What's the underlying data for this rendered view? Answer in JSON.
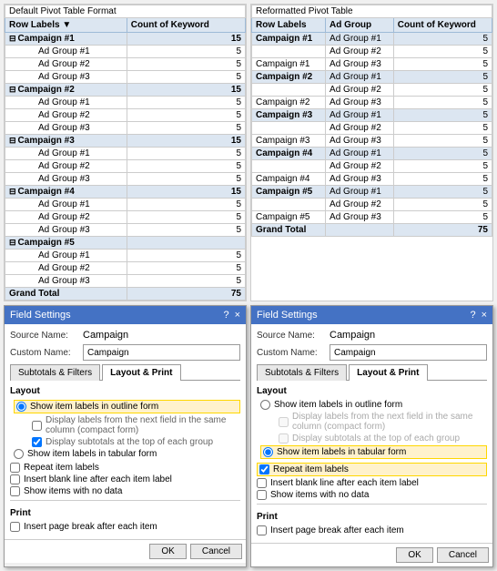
{
  "left_pivot": {
    "title": "Default Pivot Table Format",
    "col1": "Row Labels",
    "col2": "Count of Keyword",
    "rows": [
      {
        "type": "campaign",
        "label": "Campaign #1",
        "value": "15",
        "expanded": true
      },
      {
        "type": "adgroup",
        "label": "Ad Group #1",
        "value": "5"
      },
      {
        "type": "adgroup",
        "label": "Ad Group #2",
        "value": "5"
      },
      {
        "type": "adgroup",
        "label": "Ad Group #3",
        "value": "5"
      },
      {
        "type": "campaign",
        "label": "Campaign #2",
        "value": "15",
        "expanded": true
      },
      {
        "type": "adgroup",
        "label": "Ad Group #1",
        "value": "5"
      },
      {
        "type": "adgroup",
        "label": "Ad Group #2",
        "value": "5"
      },
      {
        "type": "adgroup",
        "label": "Ad Group #3",
        "value": "5"
      },
      {
        "type": "campaign",
        "label": "Campaign #3",
        "value": "15",
        "expanded": true
      },
      {
        "type": "adgroup",
        "label": "Ad Group #1",
        "value": "5"
      },
      {
        "type": "adgroup",
        "label": "Ad Group #2",
        "value": "5"
      },
      {
        "type": "adgroup",
        "label": "Ad Group #3",
        "value": "5"
      },
      {
        "type": "campaign",
        "label": "Campaign #4",
        "value": "15",
        "expanded": true
      },
      {
        "type": "adgroup",
        "label": "Ad Group #1",
        "value": "5"
      },
      {
        "type": "adgroup",
        "label": "Ad Group #2",
        "value": "5"
      },
      {
        "type": "adgroup",
        "label": "Ad Group #3",
        "value": "5"
      },
      {
        "type": "campaign",
        "label": "Campaign #5",
        "value": "",
        "expanded": true
      },
      {
        "type": "adgroup",
        "label": "Ad Group #1",
        "value": "5"
      },
      {
        "type": "adgroup",
        "label": "Ad Group #2",
        "value": "5"
      },
      {
        "type": "adgroup",
        "label": "Ad Group #3",
        "value": "5"
      },
      {
        "type": "total",
        "label": "Grand Total",
        "value": "75"
      }
    ]
  },
  "right_pivot": {
    "title": "Reformatted Pivot Table",
    "col1": "Row Labels",
    "col2": "Ad Group",
    "col3": "Count of Keyword",
    "rows": [
      {
        "campaign": "Campaign #1",
        "adgroup": "Ad Group #1",
        "value": "5"
      },
      {
        "campaign": "",
        "adgroup": "Ad Group #2",
        "value": "5"
      },
      {
        "campaign": "Campaign #1",
        "adgroup": "Ad Group #3",
        "value": "5"
      },
      {
        "campaign": "Campaign #2",
        "adgroup": "Ad Group #1",
        "value": "5"
      },
      {
        "campaign": "",
        "adgroup": "Ad Group #2",
        "value": "5"
      },
      {
        "campaign": "Campaign #2",
        "adgroup": "Ad Group #3",
        "value": "5"
      },
      {
        "campaign": "Campaign #3",
        "adgroup": "Ad Group #1",
        "value": "5"
      },
      {
        "campaign": "",
        "adgroup": "Ad Group #2",
        "value": "5"
      },
      {
        "campaign": "Campaign #3",
        "adgroup": "Ad Group #3",
        "value": "5"
      },
      {
        "campaign": "Campaign #4",
        "adgroup": "Ad Group #1",
        "value": "5"
      },
      {
        "campaign": "",
        "adgroup": "Ad Group #2",
        "value": "5"
      },
      {
        "campaign": "Campaign #4",
        "adgroup": "Ad Group #3",
        "value": "5"
      },
      {
        "campaign": "Campaign #5",
        "adgroup": "Ad Group #1",
        "value": "5"
      },
      {
        "campaign": "",
        "adgroup": "Ad Group #2",
        "value": "5"
      },
      {
        "campaign": "Campaign #5",
        "adgroup": "Ad Group #3",
        "value": "5"
      },
      {
        "campaign": "Grand Total",
        "adgroup": "",
        "value": "75",
        "type": "total"
      }
    ]
  },
  "left_dialog": {
    "title": "Field Settings",
    "help": "?",
    "close": "×",
    "source_label": "Source Name:",
    "source_value": "Campaign",
    "custom_label": "Custom Name:",
    "custom_value": "Campaign",
    "tab1": "Subtotals & Filters",
    "tab2": "Layout & Print",
    "section_layout": "Layout",
    "layout_options": [
      {
        "label": "Show item labels in outline form",
        "selected": true,
        "highlighted": true
      },
      {
        "label": "Display labels from the next field in the same column (compact form)",
        "selected": false,
        "sub": true,
        "disabled": false
      },
      {
        "label": "Display subtotals at the top of each group",
        "selected": true,
        "sub": true
      },
      {
        "label": "Show item labels in tabular form",
        "selected": false
      }
    ],
    "extra_options": [
      {
        "label": "Repeat item labels",
        "selected": false
      },
      {
        "label": "Insert blank line after each item label",
        "selected": false
      },
      {
        "label": "Show items with no data",
        "selected": false
      }
    ],
    "print_section": "Print",
    "print_option": "Insert page break after each item",
    "ok": "OK",
    "cancel": "Cancel"
  },
  "right_dialog": {
    "title": "Field Settings",
    "help": "?",
    "close": "×",
    "source_label": "Source Name:",
    "source_value": "Campaign",
    "custom_label": "Custom Name:",
    "custom_value": "Campaign",
    "tab1": "Subtotals & Filters",
    "tab2": "Layout & Print",
    "section_layout": "Layout",
    "layout_options": [
      {
        "label": "Show item labels in outline form",
        "selected": false
      },
      {
        "label": "Display labels from the next field in the same column (compact form)",
        "selected": false,
        "sub": true,
        "disabled": true
      },
      {
        "label": "Display subtotals at the top of each group",
        "selected": false,
        "sub": true,
        "disabled": true
      },
      {
        "label": "Show item labels in tabular form",
        "selected": true,
        "highlighted": true
      }
    ],
    "extra_options": [
      {
        "label": "Repeat item labels",
        "selected": true,
        "highlighted": true
      },
      {
        "label": "Insert blank line after each item label",
        "selected": false
      },
      {
        "label": "Show items with no data",
        "selected": false
      }
    ],
    "print_section": "Print",
    "print_option": "Insert page break after each item",
    "ok": "OK",
    "cancel": "Cancel"
  }
}
